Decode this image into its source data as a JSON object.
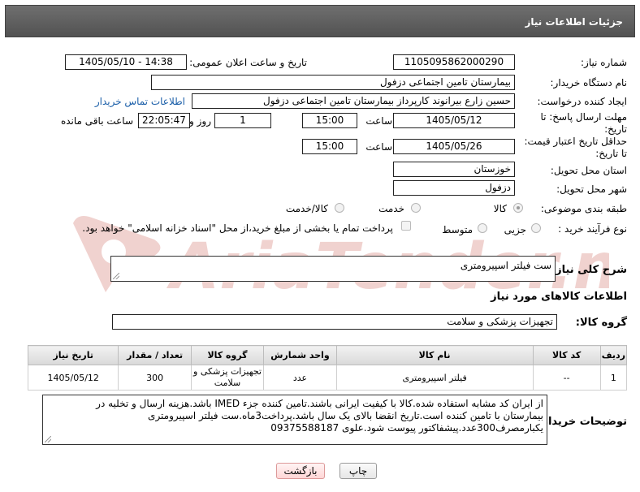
{
  "header": {
    "title": "جزئیات اطلاعات نیاز"
  },
  "need": {
    "number_label": "شماره نیاز:",
    "number_value": "1105095862000290",
    "announce_label": "تاریخ و ساعت اعلان عمومی:",
    "announce_value": "1405/05/10 - 14:38"
  },
  "buyer": {
    "label": "نام دستگاه خریدار:",
    "value": "بیمارستان تامین اجتماعی دزفول"
  },
  "requester": {
    "label": "ایجاد کننده درخواست:",
    "value": "حسین زارع بیرانوند کارپرداز بیمارستان تامین اجتماعی دزفول",
    "contact_link": "اطلاعات تماس خریدار"
  },
  "reply_deadline": {
    "label_line1": "مهلت ارسال پاسخ: تا",
    "label_line2": "تاریخ:",
    "date": "1405/05/12",
    "time_label": "ساعت",
    "time": "15:00",
    "days": "1",
    "days_label": "روز و",
    "remaining": "22:05:47",
    "remaining_label": "ساعت باقی مانده"
  },
  "price_validity": {
    "label_line1": "حداقل تاریخ اعتبار قیمت:",
    "label_line2": "تا تاریخ:",
    "date": "1405/05/26",
    "time_label": "ساعت",
    "time": "15:00"
  },
  "province": {
    "label": "استان محل تحویل:",
    "value": "خوزستان"
  },
  "city": {
    "label": "شهر محل تحویل:",
    "value": "دزفول"
  },
  "category": {
    "label": "طبقه بندی موضوعی:",
    "options": [
      "کالا",
      "خدمت",
      "کالا/خدمت"
    ],
    "selected": "کالا"
  },
  "process": {
    "label": "نوع فرآیند خرید :",
    "options": [
      "جزیی",
      "متوسط"
    ],
    "note": "پرداخت تمام یا بخشی از مبلغ خرید،از محل \"اسناد خزانه اسلامی\" خواهد بود."
  },
  "description": {
    "label": "شرح کلی نیاز:",
    "value": "ست فیلتر اسپیرومتری"
  },
  "goods_info": {
    "title": "اطلاعات کالاهای مورد نیاز",
    "group_label": "گروه کالا:",
    "group_value": "تجهیزات پزشکی و سلامت"
  },
  "table": {
    "headers": [
      "ردیف",
      "کد کالا",
      "نام کالا",
      "واحد شمارش",
      "گروه کالا",
      "تعداد / مقدار",
      "تاریخ نیاز"
    ],
    "rows": [
      [
        "1",
        "--",
        "فیلتر اسپیرومتری",
        "عدد",
        "تجهیزات پزشکی و سلامت",
        "300",
        "1405/05/12"
      ]
    ]
  },
  "buyer_notes": {
    "label": "توضیحات خریدار:",
    "value": "از ایران کد مشابه استفاده شده.کالا با کیفیت ایرانی باشند.تامین کننده جزء IMED باشد.هزینه ارسال و تخلیه در بیمارستان با تامین کننده است.تاریخ انقضا بالای یک سال باشد.پرداخت3ماه.ست فیلتر اسپیرومتری یکبارمصرف300عدد.پیشفاکتور پیوست شود.علوی 09375588187"
  },
  "buttons": {
    "print": "چاپ",
    "back": "بازگشت"
  },
  "watermark": {
    "text": "AriaTender.net"
  },
  "colors": {
    "header_bg": "#5e5e5e",
    "link": "#1a5ea8",
    "watermark": "#c0392b"
  }
}
